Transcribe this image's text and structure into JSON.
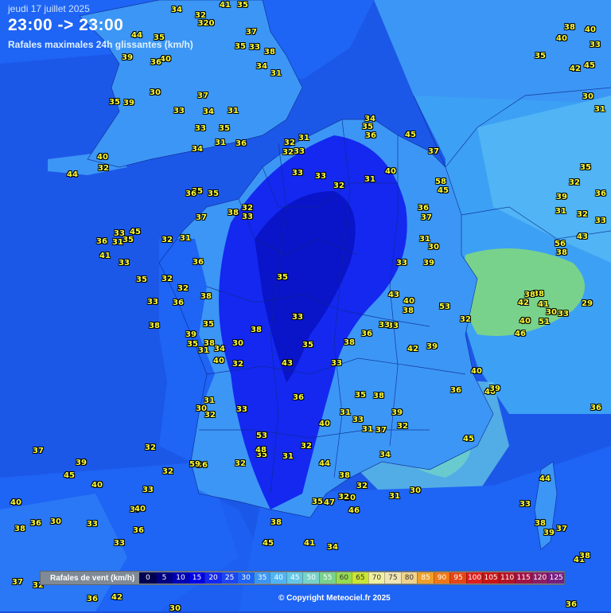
{
  "header": {
    "date": "jeudi 17 juillet 2025",
    "time_range": "23:00 -> 23:00",
    "subtitle": "Rafales maximales 24h glissantes (km/h)"
  },
  "legend": {
    "title": "Rafales de vent (km/h)",
    "steps": [
      {
        "label": "0",
        "color": "#000050"
      },
      {
        "label": "5",
        "color": "#000080"
      },
      {
        "label": "10",
        "color": "#0000b4"
      },
      {
        "label": "15",
        "color": "#0000e6"
      },
      {
        "label": "20",
        "color": "#1428f0"
      },
      {
        "label": "25",
        "color": "#1e46f0"
      },
      {
        "label": "30",
        "color": "#1e64f5"
      },
      {
        "label": "35",
        "color": "#3c96f5"
      },
      {
        "label": "40",
        "color": "#50b4f5"
      },
      {
        "label": "45",
        "color": "#64c8e6"
      },
      {
        "label": "50",
        "color": "#78d2c8"
      },
      {
        "label": "55",
        "color": "#78d28c"
      },
      {
        "label": "60",
        "color": "#96dc50"
      },
      {
        "label": "65",
        "color": "#c8e632"
      },
      {
        "label": "70",
        "color": "#f0f0a0"
      },
      {
        "label": "75",
        "color": "#f0e6b4"
      },
      {
        "label": "80",
        "color": "#f0d28c"
      },
      {
        "label": "85",
        "color": "#f0a028"
      },
      {
        "label": "90",
        "color": "#f07814"
      },
      {
        "label": "95",
        "color": "#e64614"
      },
      {
        "label": "100",
        "color": "#dc1e1e"
      },
      {
        "label": "105",
        "color": "#c81414"
      },
      {
        "label": "110",
        "color": "#b41428"
      },
      {
        "label": "115",
        "color": "#a01446"
      },
      {
        "label": "120",
        "color": "#8c1e64"
      },
      {
        "label": "125",
        "color": "#781e82"
      }
    ]
  },
  "copyright": "© Copyright Meteociel.fr 2025",
  "station_values": [
    "41",
    "35",
    "34",
    "32",
    "320",
    "44",
    "35",
    "37",
    "39",
    "40",
    "36",
    "35",
    "33",
    "38",
    "34",
    "31",
    "30",
    "37",
    "35",
    "39",
    "33",
    "31",
    "34",
    "33",
    "35",
    "34",
    "31",
    "36",
    "40",
    "32",
    "44",
    "35",
    "35",
    "36",
    "38",
    "32",
    "33",
    "37",
    "31",
    "32",
    "33",
    "31",
    "36",
    "45",
    "35",
    "36",
    "41",
    "33",
    "35",
    "32",
    "32",
    "36",
    "38",
    "33",
    "38",
    "35",
    "39",
    "38",
    "35",
    "31",
    "34",
    "30",
    "32",
    "40",
    "31",
    "30",
    "32",
    "33",
    "31",
    "32",
    "32",
    "33",
    "34",
    "35",
    "36",
    "45",
    "37",
    "33",
    "33",
    "32",
    "31",
    "40",
    "36",
    "37",
    "58",
    "45",
    "30",
    "31",
    "39",
    "53",
    "33",
    "38",
    "43",
    "40",
    "33",
    "36",
    "33",
    "38",
    "42",
    "39",
    "32",
    "35",
    "38",
    "39",
    "37",
    "31",
    "32",
    "31",
    "40",
    "33",
    "44",
    "32",
    "38",
    "36",
    "33",
    "35",
    "33",
    "38",
    "35",
    "43",
    "53",
    "35",
    "31",
    "32",
    "30",
    "48",
    "32",
    "36",
    "59",
    "32",
    "32",
    "33",
    "37",
    "39",
    "45",
    "40",
    "37",
    "40",
    "36",
    "30",
    "33",
    "40",
    "36",
    "33",
    "38",
    "37",
    "32",
    "36",
    "42",
    "30",
    "45",
    "38",
    "41",
    "34",
    "47",
    "35",
    "32",
    "46",
    "34",
    "31",
    "30",
    "45",
    "40",
    "36",
    "40",
    "39",
    "36",
    "44",
    "38",
    "33",
    "39",
    "37",
    "36",
    "41",
    "38",
    "40",
    "33",
    "45",
    "42",
    "35",
    "40",
    "38",
    "30",
    "31",
    "35",
    "36",
    "33",
    "32",
    "29",
    "39",
    "31",
    "32",
    "43",
    "38",
    "38",
    "41",
    "42",
    "38",
    "40",
    "46",
    "51",
    "30",
    "33",
    "56",
    "39",
    "43",
    "54",
    "60",
    "41",
    "53",
    "71"
  ]
}
